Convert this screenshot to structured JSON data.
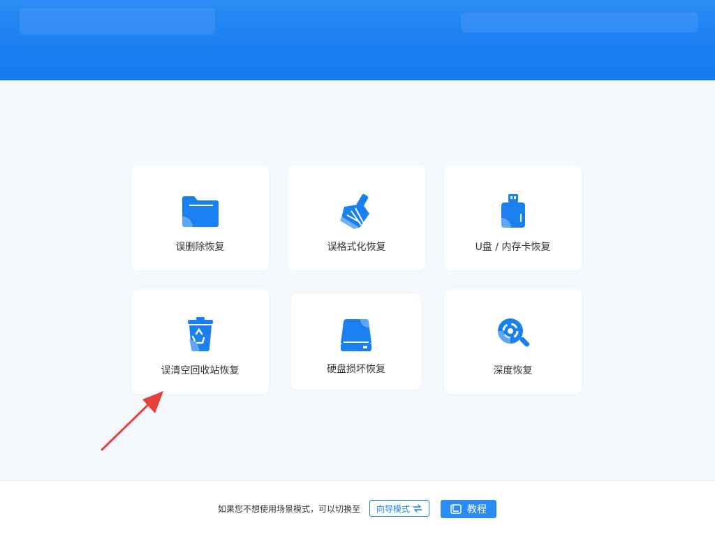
{
  "cards": [
    {
      "label": "误删除恢复",
      "icon": "folder-icon"
    },
    {
      "label": "误格式化恢复",
      "icon": "broom-icon"
    },
    {
      "label": "U盘 / 内存卡恢复",
      "icon": "usb-drive-icon"
    },
    {
      "label": "误清空回收站恢复",
      "icon": "recycle-bin-icon"
    },
    {
      "label": "硬盘损坏恢复",
      "icon": "hard-disk-icon"
    },
    {
      "label": "深度恢复",
      "icon": "deep-scan-icon"
    }
  ],
  "footer": {
    "hint": "如果您不想使用场景模式，可以切换至",
    "guide_label": "向导模式",
    "tutorial_label": "教程"
  },
  "colors": {
    "header": "#1a7ef0",
    "accent": "#1a80f0",
    "background": "#f5f8fd",
    "arrow": "#e8413a"
  }
}
